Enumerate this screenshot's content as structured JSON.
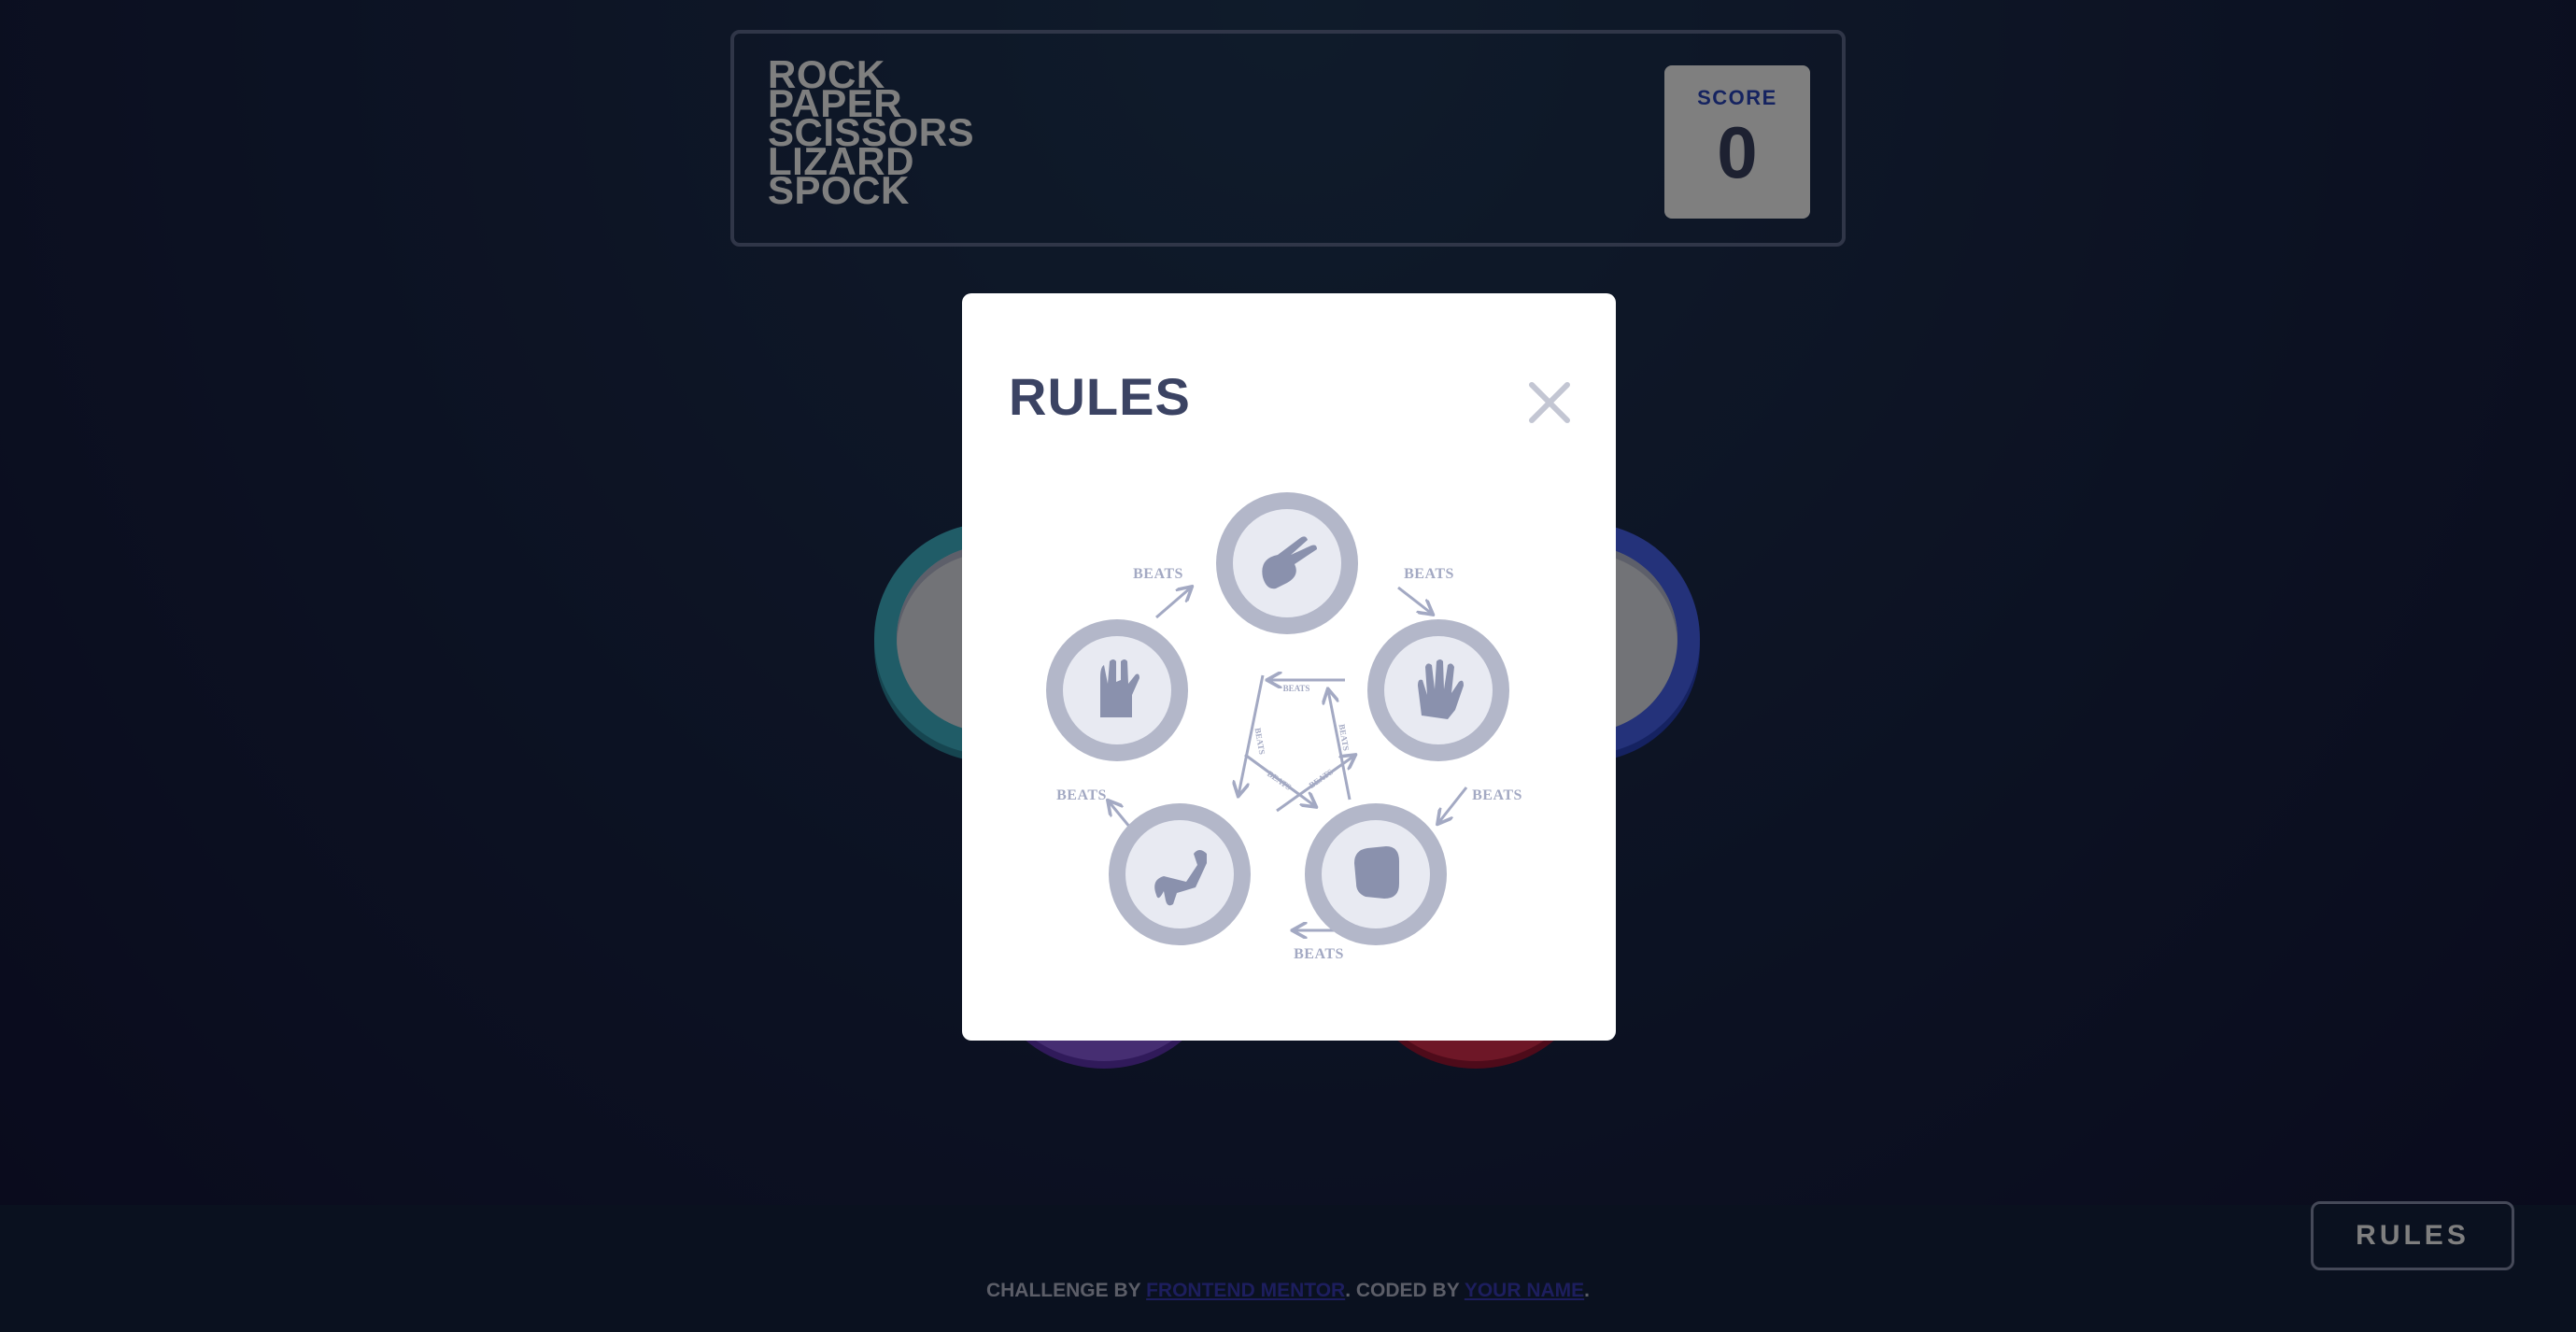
{
  "header": {
    "title_lines": [
      "ROCK",
      "PAPER",
      "SCISSORS",
      "LIZARD",
      "SPOCK"
    ],
    "score_label": "SCORE",
    "score_value": "0"
  },
  "game": {
    "choices": [
      "spock",
      "scissors",
      "lizard",
      "rock"
    ]
  },
  "footer": {
    "challenge_by": "CHALLENGE BY",
    "challenge_link": "FRONTEND MENTOR",
    "coded_by": ". CODED BY",
    "coder_link": "YOUR NAME",
    "suffix": ".",
    "rules_button": "RULES"
  },
  "modal": {
    "title": "RULES",
    "beats_label": "BEATS",
    "icons": [
      "scissors-icon",
      "paper-icon",
      "rock-icon",
      "lizard-icon",
      "spock-icon",
      "close-icon"
    ],
    "colors": {
      "icon_ring": "#b3b7c9",
      "icon_inner": "#e8eaf2",
      "icon_fill": "#8a91ad",
      "arrow": "#a3a9c3",
      "title": "#3b4363"
    }
  }
}
